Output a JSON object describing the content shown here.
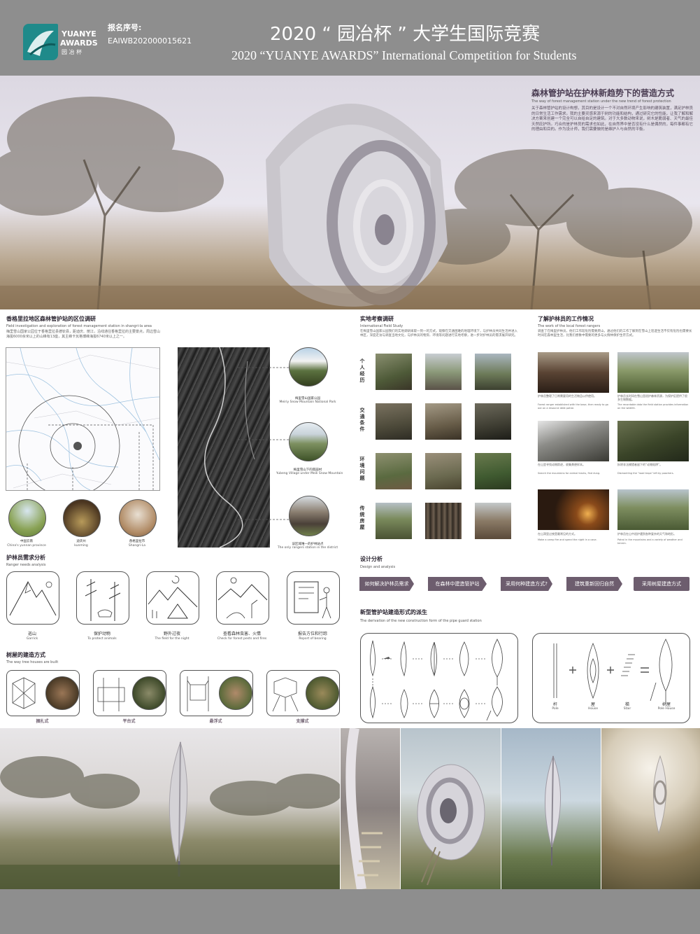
{
  "header": {
    "logo_top": "YUANYE",
    "logo_mid": "AWARDS",
    "logo_bottom": "园 冶 杯",
    "reg_label": "报名序号:",
    "reg_number": "EAIWB202000015621",
    "title_cn": "2020 “ 园冶杯 ” 大学生国际竞赛",
    "title_en": "2020 “YUANYE AWARDS” International Competition for  Students"
  },
  "hero": {
    "title_cn": "森林管护站在护林新趋势下的营造方式",
    "title_en": "The way of forest management station under the new trend of forest protection",
    "body": "关于森林管护站的设计构想，其目的是设计一个不对自然环境产生影响的建筑装置，满足护林员的日常生活工作需求。我的主要灵感来源于树的功能和结构，通过研究它的性能，让我了解和解决方案来创建一个完全可以自给自足的建筑。对于大多数动物来说，树木是脆弱者、天气的最佳天然庇护所。巧合的是护林员的需求也如此，在自然界中是否没有什么是偶然的，每件事都有它的理由和目的。作为设计师，我们需要做的是维护人与自然的平衡。"
  },
  "section_location": {
    "title_cn": "香格里拉地区森林管护站的区位调研",
    "title_en": "Field investigation and exploration of forest management station in shangri-la area",
    "body": "梅里雪山国家公园位于香格里拉县德钦县，距迪庆、丽江，沿线通往香格里拉的主要景点，周边雪山海拔6000余米以上的山峰有13座，其主峰卡瓦格博峰海拔6740米以上之一。",
    "map_circles": [
      {
        "cn": "中国云南",
        "en": "China's yunnan province"
      },
      {
        "cn": "迪庆州",
        "en": "kunming"
      },
      {
        "cn": "香格里拉市",
        "en": "Shangri-La"
      }
    ],
    "aerial_circles": [
      {
        "cn": "梅里雪山国家公园",
        "en": "Meiriy Snow Mountain National Park"
      },
      {
        "cn": "梅里雪山下的雨崩村",
        "en": "Yubeng Village under Meili Snow Mountain"
      },
      {
        "cn": "该区域唯一的护林站点",
        "en": "The only rangers station in the district"
      }
    ]
  },
  "section_field": {
    "title_cn": "实地考察调研",
    "title_en": "International Field Study",
    "body": "在梅里雪山国家公园我们的实地调研采取一到一的方式，观察在交通困难的地理环境下，与护林员共同生活并进入林区，深度走访与调查当地文化，与护林员的物资、环境等问题进行实地考察，进一步对护林员的需求展开研究。",
    "row_labels": [
      "个人经历",
      "交通条件",
      "环境问题",
      "传统房屋"
    ]
  },
  "section_work": {
    "title_cn": "了解护林员的工作情况",
    "title_en": "The work of the local forest rangers",
    "body": "调查了在梅里护林员，他们工作较危险需要爬山，通过他们的工作了解到在雪山上巡逻生活不仅有危险也需要长时间在森林里生活，比我们想象中需要的更多与火情林保护生存方式。",
    "items": [
      {
        "cn": "护林员整理了日常需要用的生活物品以供使用。",
        "en": "Forest ranger established with the base, then ready to go out on a resource debt patrol."
      },
      {
        "cn": "护林员长时间在雪山里巡护森林资源，为保护区提供了很多生物数据。",
        "en": "The recordable data the field station provides information on the wildlife."
      },
      {
        "cn": "在山里寻找动物踪迹，收集粪便样本。",
        "en": "Search the mountains for animal tracks, find dung."
      },
      {
        "cn": "拆除非法捕猎者留下的“动物陷阱”。",
        "en": "Dismantling the \"road traps\" left by poachers."
      },
      {
        "cn": "在山洞里过夜是最常见的方式。",
        "en": "Make a camp fire and spend the night in a cave."
      },
      {
        "cn": "护林员在山中巡护遇到各种复杂的天气和地形。",
        "en": "Patrol in the mountains and a variety of weather and terrain."
      }
    ]
  },
  "section_needs": {
    "title_cn": "护林员需求分析",
    "title_en": "Ranger needs analysis",
    "items": [
      {
        "cn": "巡山",
        "en": "Garrick"
      },
      {
        "cn": "保护动物",
        "en": "To protect animals"
      },
      {
        "cn": "野外过夜",
        "en": "The field for the night"
      },
      {
        "cn": "查看森林虫害、火情",
        "en": "Check for forest pests and fires"
      },
      {
        "cn": "报告方位和行踪",
        "en": "Report of bearing"
      }
    ]
  },
  "section_treehouse": {
    "title_cn": "树屋的建造方式",
    "title_en": "The way tree houses are built",
    "items": [
      "捆扎式",
      "平台式",
      "悬浮式",
      "支撑式"
    ]
  },
  "section_design": {
    "title_cn": "设计分析",
    "title_en": "Design and analysis",
    "flow": [
      "如何解决护林员需求",
      "在森林中建造管护站",
      "采用何种建造方式?",
      "建筑重新回归自然",
      "采用树屋建造方式"
    ]
  },
  "section_derivation": {
    "title_cn": "新型管护站建造形式的派生",
    "title_en": "The derivation of the new construction form of the pipe guard station",
    "labels": [
      {
        "cn": "杆",
        "en": "Pole"
      },
      {
        "cn": "屋",
        "en": "House"
      },
      {
        "cn": "梯",
        "en": "Stair"
      },
      {
        "cn": "树屋",
        "en": "Pole House"
      }
    ]
  },
  "colors": {
    "band": "#8e8e8e",
    "logo_teal": "#1f8a8a",
    "flow_purple": "#6d5d6e",
    "sky": "#e6e2ea"
  }
}
